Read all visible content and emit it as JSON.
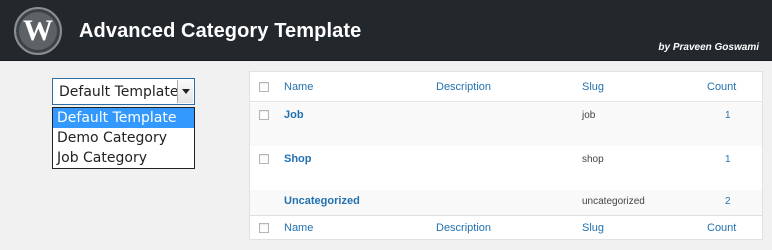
{
  "header": {
    "logo_glyph": "W",
    "logo_icon": "wordpress-logo-icon",
    "title": "Advanced Category Template",
    "byline": "by Praveen Goswami"
  },
  "template_select": {
    "value": "Default Template",
    "options": [
      "Default Template",
      "Demo Category",
      "Job Category"
    ],
    "selected_index": 0
  },
  "table": {
    "columns": {
      "name": "Name",
      "description": "Description",
      "slug": "Slug",
      "count": "Count"
    },
    "rows": [
      {
        "name": "Job",
        "description": "",
        "slug": "job",
        "count": "1"
      },
      {
        "name": "Shop",
        "description": "",
        "slug": "shop",
        "count": "1"
      },
      {
        "name": "Uncategorized",
        "description": "",
        "slug": "uncategorized",
        "count": "2"
      }
    ]
  },
  "colors": {
    "topbar": "#23282d",
    "link": "#2271b1",
    "selected_option": "#3399ff"
  }
}
